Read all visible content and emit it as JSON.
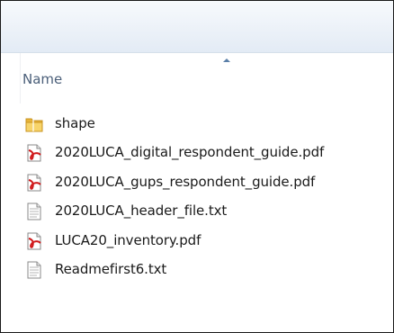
{
  "columns": {
    "name_label": "Name"
  },
  "files": [
    {
      "name": "shape",
      "icon": "folder-icon"
    },
    {
      "name": "2020LUCA_digital_respondent_guide.pdf",
      "icon": "pdf-icon"
    },
    {
      "name": "2020LUCA_gups_respondent_guide.pdf",
      "icon": "pdf-icon"
    },
    {
      "name": "2020LUCA_header_file.txt",
      "icon": "text-file-icon"
    },
    {
      "name": "LUCA20_inventory.pdf",
      "icon": "pdf-icon"
    },
    {
      "name": "Readmefirst6.txt",
      "icon": "text-file-icon"
    }
  ],
  "colors": {
    "header_text": "#4c607a",
    "file_text": "#1a1a1a",
    "folder_yellow": "#f2c94c",
    "pdf_red": "#d0191b"
  }
}
